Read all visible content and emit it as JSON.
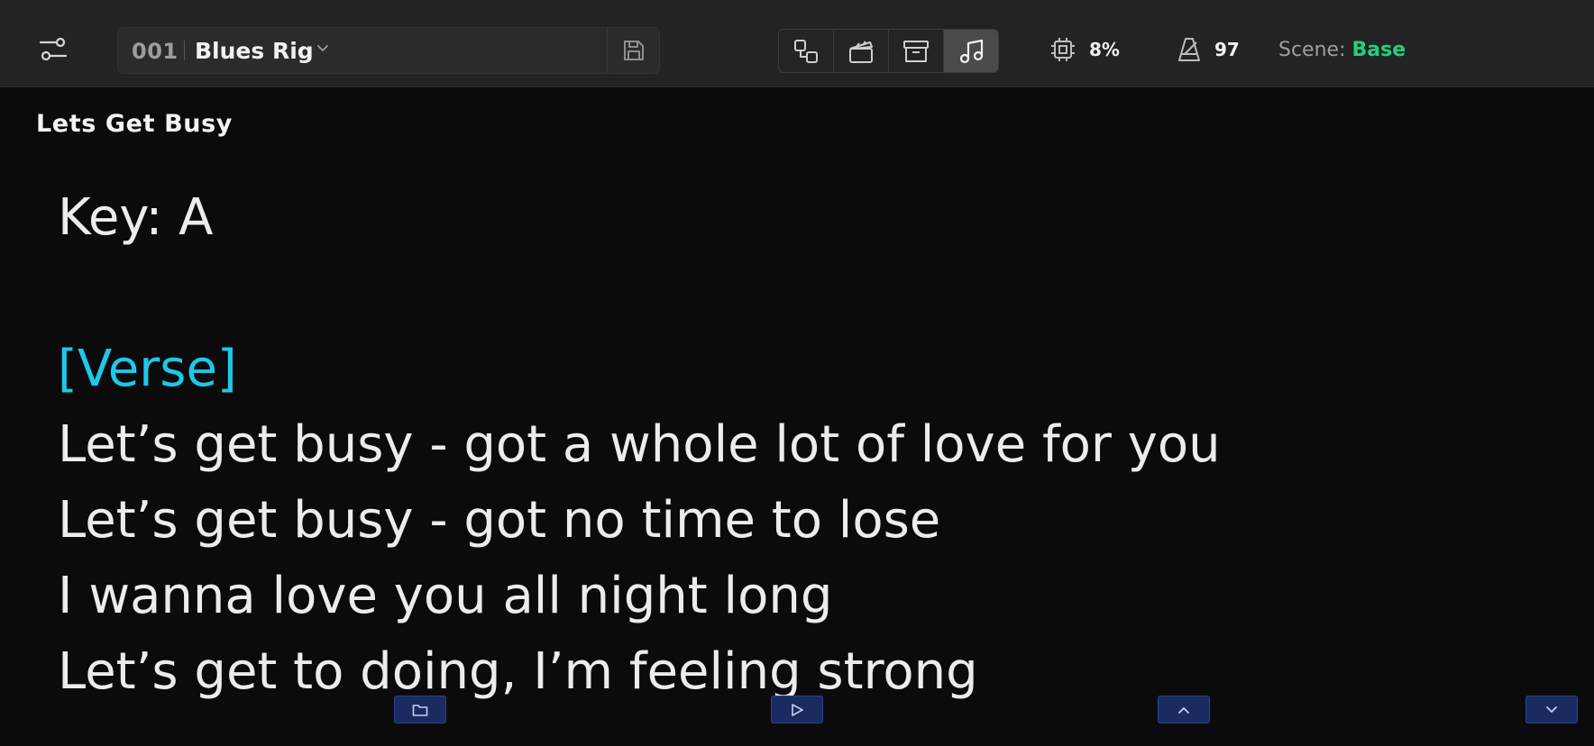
{
  "topbar": {
    "menu_icon": "sliders-icon",
    "preset": {
      "number": "001",
      "name": "Blues Rig",
      "dropdown_icon": "chevron-down-icon",
      "save_icon": "save-icon"
    },
    "views": [
      {
        "icon": "signal-chain-icon",
        "active": false
      },
      {
        "icon": "clapperboard-icon",
        "active": false
      },
      {
        "icon": "archive-icon",
        "active": false
      },
      {
        "icon": "music-note-icon",
        "active": true
      }
    ],
    "cpu": {
      "icon": "cpu-chip-icon",
      "value": "8%"
    },
    "tempo": {
      "icon": "metronome-icon",
      "value": "97"
    },
    "scene": {
      "label": "Scene:",
      "value": "Base"
    }
  },
  "song": {
    "title": "Lets Get Busy",
    "lines": [
      {
        "text": "Key: A",
        "type": "text"
      },
      {
        "text": "",
        "type": "blank"
      },
      {
        "text": "[Verse]",
        "type": "section"
      },
      {
        "text": "Let’s get busy - got a whole lot of love for you",
        "type": "text"
      },
      {
        "text": "Let’s get busy - got no time to lose",
        "type": "text"
      },
      {
        "text": "I wanna love you all night long",
        "type": "text"
      },
      {
        "text": "Let’s get to doing, I’m feeling strong",
        "type": "text"
      }
    ]
  },
  "bottom_controls": [
    {
      "icon": "folder-icon"
    },
    {
      "icon": "play-icon"
    },
    {
      "icon": "chevron-up-icon"
    },
    {
      "icon": "chevron-down-icon"
    }
  ],
  "colors": {
    "background": "#0b0b0c",
    "topbar": "#232325",
    "section_heading": "#1ec8e8",
    "scene_value": "#22d17a",
    "bottom_button": "#1a2b61"
  }
}
